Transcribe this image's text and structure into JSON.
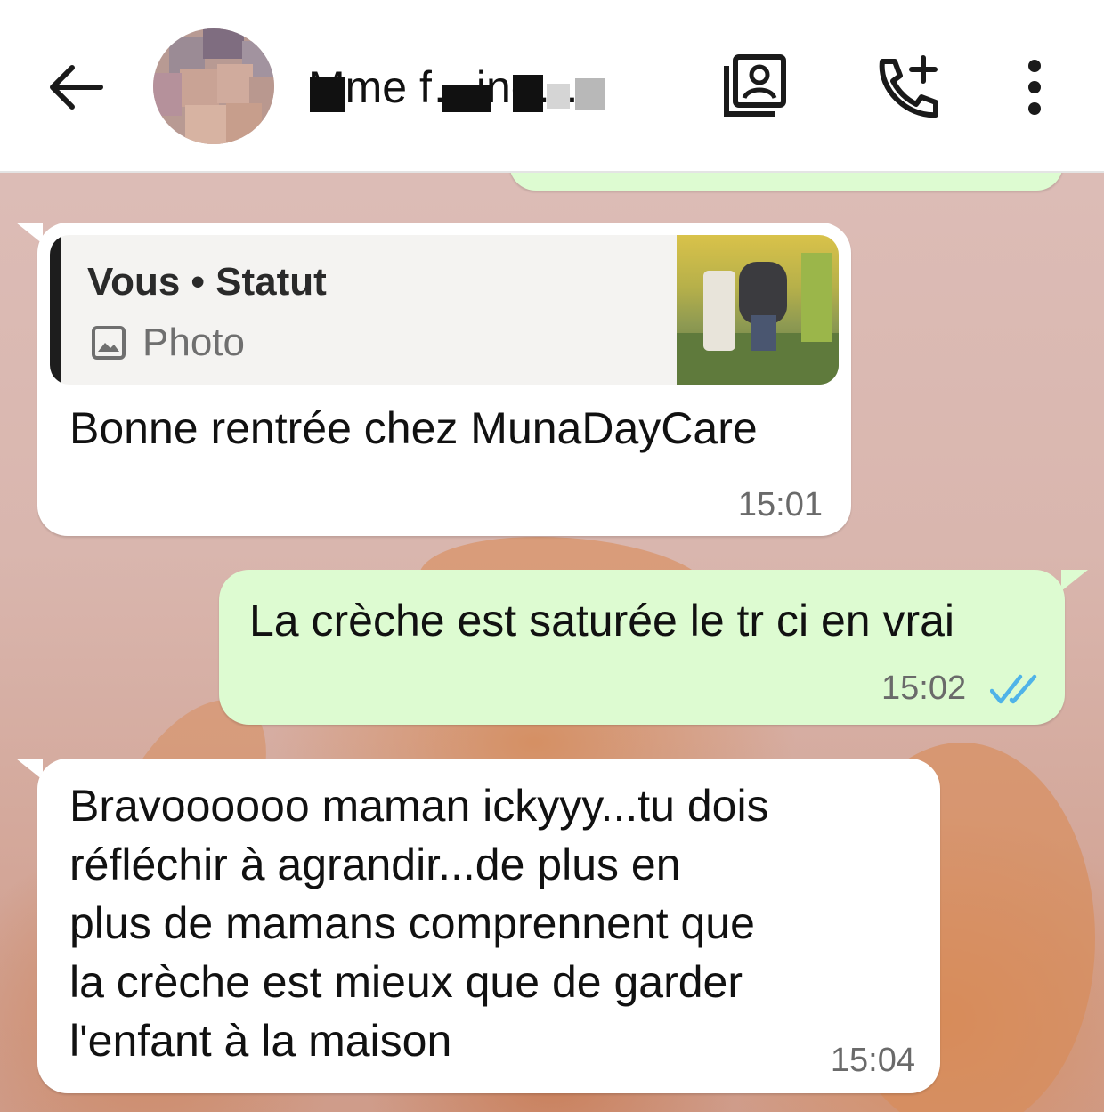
{
  "header": {
    "contact_name": "Mme f…ine…",
    "back_icon": "arrow-left-icon",
    "contact_card_icon": "contact-card-icon",
    "add_call_icon": "phone-plus-icon",
    "menu_icon": "more-vertical-icon"
  },
  "messages": [
    {
      "direction": "incoming",
      "quote": {
        "title": "Vous • Statut",
        "type_label": "Photo",
        "type_icon": "image-icon"
      },
      "text": "Bonne rentrée chez MunaDayCare",
      "time": "15:01"
    },
    {
      "direction": "outgoing",
      "text": "La crèche est saturée le tr ci en vrai",
      "time": "15:02",
      "status": "read",
      "status_color": "#4fb3e8"
    },
    {
      "direction": "incoming",
      "text": "Bravoooooo maman ickyyy...tu dois\nréfléchir à agrandir...de plus en\nplus de mamans comprennent que\nla crèche est mieux que de garder\nl'enfant à la maison",
      "time": "15:04"
    }
  ],
  "colors": {
    "incoming_bubble": "#ffffff",
    "outgoing_bubble": "#ddfbd1",
    "wallpaper": "#d9b6ae",
    "read_ticks": "#4fb3e8"
  }
}
